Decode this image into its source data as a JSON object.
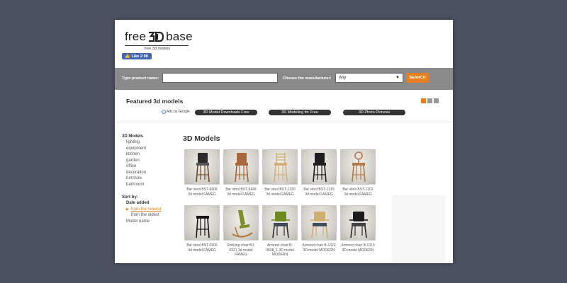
{
  "header": {
    "logo_left": "free",
    "logo_right": "base",
    "logo_sub": "free 3d models",
    "fb_like": "Like 2.9K"
  },
  "search": {
    "product_label": "Type product name:",
    "product_value": "",
    "manufacturer_label": "Choose the manufacturer:",
    "manufacturer_value": "Any",
    "button_label": "SEARCH"
  },
  "featured": {
    "title": "Featured 3d models",
    "ads_label": "Ads by Google",
    "ad_links": [
      "3D Model Downloads Free",
      "3D Modeling for Free",
      "3D Photo Pictures"
    ]
  },
  "sidebar": {
    "heading": "3D Models",
    "items": [
      "lighting",
      "equipment",
      "kitchen",
      "garden",
      "office",
      "decoration",
      "furniture",
      "bathroom"
    ],
    "sort": {
      "heading": "Sort by:",
      "date_added": "Date added",
      "newest": "from the newest",
      "oldest": "from the oldest",
      "model_name": "Model name"
    }
  },
  "main": {
    "title": "3D Models",
    "models": [
      {
        "title": "Bar stool BST-9608 3d model FAMEG",
        "kind": "barstool-dark-seat",
        "color": "#2b2b2b"
      },
      {
        "title": "Bar stool BST-9449 3d model FAMEG",
        "kind": "barstool-wood",
        "color": "#a8683b"
      },
      {
        "title": "Bar stool BST-1320 3d model FAMEG",
        "kind": "barstool-ladder",
        "color": "#d1b07a"
      },
      {
        "title": "Bar stool BST-1319 3d model FAMEG",
        "kind": "barstool-black",
        "color": "#1e1e1e"
      },
      {
        "title": "Bar stool BST-1202 3d model FAMEG",
        "kind": "barstool-round",
        "color": "#b07a4c"
      },
      {
        "title": "Bar stool BST-0506 3d model FAMEG",
        "kind": "stool",
        "color": "#151515"
      },
      {
        "title": "Rocking chair BJ-0321 3d model FAMEG",
        "kind": "rocking-chair",
        "color": "#7d8f2a"
      },
      {
        "title": "Armrest chair B-9608_1 3D model MODERN",
        "kind": "armchair-green",
        "color": "#6f8a1e"
      },
      {
        "title": "Armrest chair B-1320 3D model MODERN",
        "kind": "armchair-light",
        "color": "#cfae72"
      },
      {
        "title": "Armrest chair B-1319 3D model MODERN",
        "kind": "armchair-black",
        "color": "#1b1b1b"
      }
    ]
  },
  "colors": {
    "accent": "#e67e22",
    "search_bar": "#8a8a8a",
    "background": "#4b5160",
    "facebook": "#4267b2"
  }
}
